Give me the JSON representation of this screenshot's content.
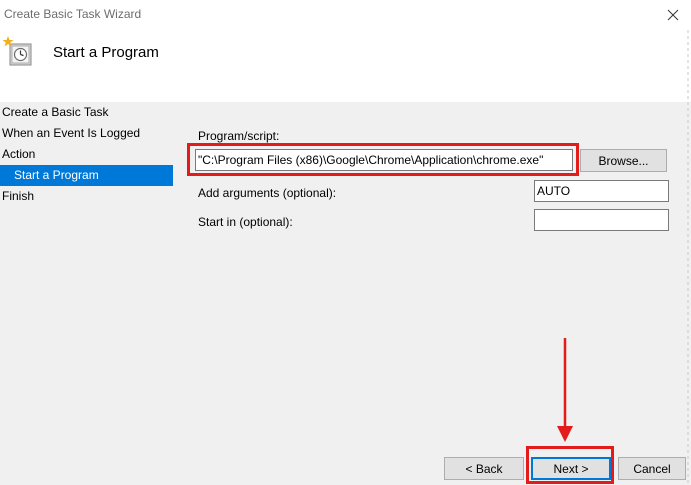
{
  "window": {
    "title": "Create Basic Task Wizard",
    "close_icon": "close-icon",
    "wizard_icon": "task-scheduler-clock-icon"
  },
  "header": {
    "heading": "Start a Program"
  },
  "sidebar": {
    "items": [
      {
        "label": "Create a Basic Task",
        "active": false
      },
      {
        "label": "When an Event Is Logged",
        "active": false
      },
      {
        "label": "Action",
        "active": false
      },
      {
        "label": "Start a Program",
        "active": true
      },
      {
        "label": "Finish",
        "active": false
      }
    ]
  },
  "form": {
    "program_label": "Program/script:",
    "program_value": "\"C:\\Program Files (x86)\\Google\\Chrome\\Application\\chrome.exe\"",
    "browse_label": "Browse...",
    "arguments_label": "Add arguments (optional):",
    "arguments_value": "AUTO",
    "startin_label": "Start in (optional):",
    "startin_value": ""
  },
  "footer": {
    "back_label": "< Back",
    "next_label": "Next >",
    "cancel_label": "Cancel"
  },
  "annotations": {
    "highlight_color": "#e31b1b",
    "arrow_icon": "down-arrow-icon"
  },
  "colors": {
    "selection": "#0078d7",
    "window_bg": "#f0f0f0",
    "header_bg": "#ffffff"
  }
}
